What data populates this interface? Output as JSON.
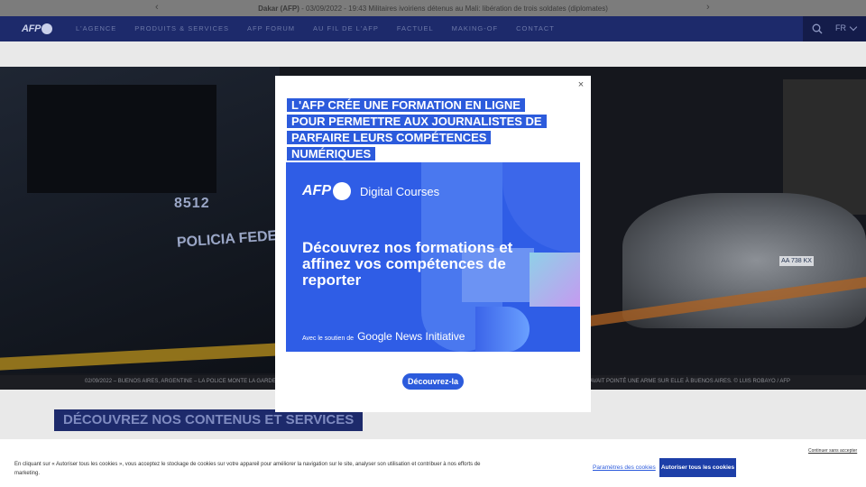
{
  "ticker": {
    "place": "Dakar (AFP)",
    "rest": " - 03/09/2022 - 19:43 Militaires ivoiriens détenus au Mali: libération de trois soldates (diplomates)"
  },
  "nav": {
    "logo": "AFP",
    "items": [
      "L'AGENCE",
      "PRODUITS & SERVICES",
      "AFP FORUM",
      "AU FIL DE L'AFP",
      "FACTUEL",
      "MAKING-OF",
      "CONTACT"
    ],
    "lang": "FR"
  },
  "hero": {
    "bus_text_1": "8512",
    "bus_text_2": "POLICIA FEDE",
    "plate": "AA 738 KX",
    "caption_left": "02/09/2022 – BUENOS AIRES, ARGENTINE – LA POLICE MONTE LA GARDE",
    "caption_right": "AVAIT POINTÉ UNE ARME SUR ELLE À BUENOS AIRES. © LUIS ROBAYO / AFP"
  },
  "section": {
    "title": "DÉCOUVREZ NOS CONTENUS ET SERVICES"
  },
  "modal": {
    "close": "×",
    "title": "L'AFP CRÉE UNE FORMATION EN LIGNE POUR PERMETTRE AUX JOURNALISTES DE PARFAIRE LEURS COMPÉTENCES NUMÉRIQUES",
    "banner_logo": "AFP",
    "banner_course": "Digital Courses",
    "banner_headline": "Découvrez nos formations et affinez vos compétences de reporter",
    "banner_support": "Avec le soutien de",
    "banner_partner": "Google News Initiative",
    "cta": "Découvrez-la"
  },
  "cookie": {
    "text": "En cliquant sur « Autoriser tous les cookies », vous acceptez le stockage de cookies sur votre appareil pour améliorer la navigation sur le site, analyser son utilisation et contribuer à nos efforts de marketing.",
    "skip": "Continuer sans accepter",
    "settings": "Paramètres des cookies",
    "accept": "Autoriser tous les cookies"
  }
}
